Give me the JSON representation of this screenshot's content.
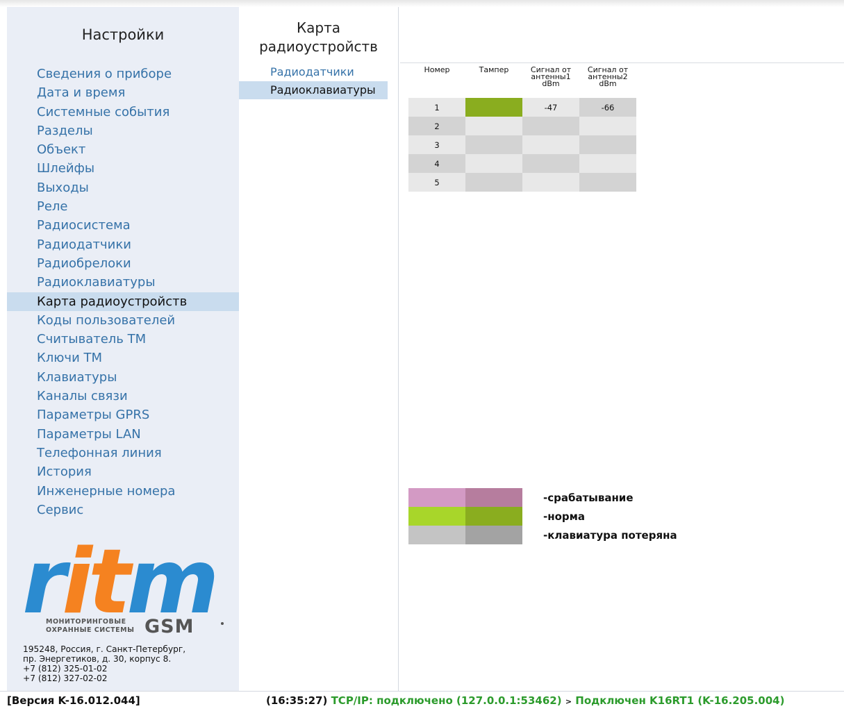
{
  "sidebar": {
    "title": "Настройки",
    "items": [
      {
        "label": "Сведения о приборе"
      },
      {
        "label": "Дата и время"
      },
      {
        "label": "Системные события"
      },
      {
        "label": "Разделы"
      },
      {
        "label": "Объект"
      },
      {
        "label": "Шлейфы"
      },
      {
        "label": "Выходы"
      },
      {
        "label": "Реле"
      },
      {
        "label": "Радиосистема"
      },
      {
        "label": "Радиодатчики"
      },
      {
        "label": "Радиобрелоки"
      },
      {
        "label": "Радиоклавиатуры"
      },
      {
        "label": "Карта радиоустройств",
        "active": true
      },
      {
        "label": "Коды пользователей"
      },
      {
        "label": "Считыватель ТМ"
      },
      {
        "label": "Ключи ТМ"
      },
      {
        "label": "Клавиатуры"
      },
      {
        "label": "Каналы связи"
      },
      {
        "label": "Параметры GPRS"
      },
      {
        "label": "Параметры LAN"
      },
      {
        "label": "Телефонная линия"
      },
      {
        "label": "История"
      },
      {
        "label": "Инженерные номера"
      },
      {
        "label": "Сервис"
      }
    ],
    "logo": {
      "brand": "ritm",
      "tagline1": "МОНИТОРИНГОВЫЕ",
      "tagline2": "ОХРАННЫЕ СИСТЕМЫ",
      "product": "GSM",
      "colors": {
        "r": "#2b8bd0",
        "i": "#f58220",
        "t": "#f58220",
        "m": "#2b8bd0"
      }
    },
    "address": [
      "195248, Россия, г. Санкт-Петербург,",
      "пр. Энергетиков, д. 30, корпус 8.",
      "+7 (812) 325-01-02",
      "+7 (812) 327-02-02"
    ]
  },
  "midpanel": {
    "title_line1": "Карта",
    "title_line2": "радиоустройств",
    "items": [
      {
        "label": "Радиодатчики"
      },
      {
        "label": "Радиоклавиатуры",
        "active": true
      }
    ]
  },
  "table": {
    "headers": [
      {
        "line1": "Номер",
        "line2": "",
        "line3": ""
      },
      {
        "line1": "Тампер",
        "line2": "",
        "line3": ""
      },
      {
        "line1": "Сигнал от",
        "line2": "антенны1",
        "line3": "dBm"
      },
      {
        "line1": "Сигнал от",
        "line2": "антенны2",
        "line3": "dBm"
      }
    ],
    "rows": [
      {
        "num": "1",
        "tamper_status": "norm",
        "ant1": "-47",
        "ant2": "-66"
      },
      {
        "num": "2",
        "tamper_status": "",
        "ant1": "",
        "ant2": ""
      },
      {
        "num": "3",
        "tamper_status": "",
        "ant1": "",
        "ant2": ""
      },
      {
        "num": "4",
        "tamper_status": "",
        "ant1": "",
        "ant2": ""
      },
      {
        "num": "5",
        "tamper_status": "",
        "ant1": "",
        "ant2": ""
      }
    ]
  },
  "legend": [
    {
      "label": "-срабатывание",
      "color1": "#d39ac4",
      "color2": "#b67d9e"
    },
    {
      "label": "-норма",
      "color1": "#a8d62a",
      "color2": "#8aad1f"
    },
    {
      "label": "-клавиатура потеряна",
      "color1": "#c4c4c4",
      "color2": "#a3a3a3"
    }
  ],
  "colors": {
    "tamper_norm": "#8aad1f",
    "cell_dark": "#d3d3d3",
    "cell_light": "#e8e8e8"
  },
  "statusbar": {
    "version": "[Версия K-16.012.044]",
    "time": "(16:35:27)",
    "connection": "TCP/IP: подключено (127.0.0.1:53462)",
    "separator": ">",
    "device": "Подключен K16RT1 (K-16.205.004)"
  }
}
